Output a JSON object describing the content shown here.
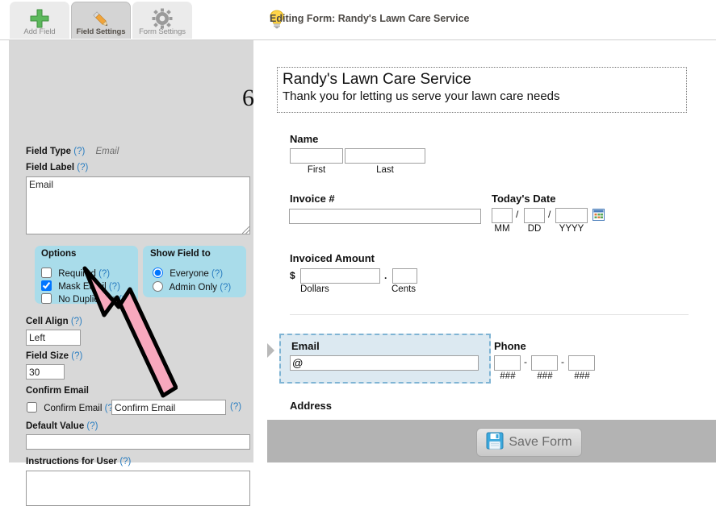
{
  "tabs": [
    {
      "label": "Add Field",
      "icon": "plus-icon",
      "active": false
    },
    {
      "label": "Field Settings",
      "icon": "pencil-icon",
      "active": true
    },
    {
      "label": "Form Settings",
      "icon": "gear-icon",
      "active": false
    }
  ],
  "header": {
    "icon": "lightbulb-icon",
    "title": "Editing Form: Randy's Lawn Care Service"
  },
  "sidebar": {
    "field_number": "6",
    "field_type_label": "Field Type",
    "field_type_value": "Email",
    "field_label_label": "Field Label",
    "field_label_value": "Email",
    "help_marker": "(?)",
    "options": {
      "title": "Options",
      "items": [
        {
          "label": "Required",
          "checked": false
        },
        {
          "label": "Mask Email",
          "checked": true
        },
        {
          "label": "No Duplicates",
          "checked": false
        }
      ]
    },
    "show_field_to": {
      "title": "Show Field to",
      "items": [
        {
          "label": "Everyone",
          "selected": true
        },
        {
          "label": "Admin Only",
          "selected": false
        }
      ]
    },
    "cell_align_label": "Cell Align",
    "cell_align_value": "Left",
    "field_size_label": "Field Size",
    "field_size_value": "30",
    "confirm_email_heading": "Confirm Email",
    "confirm_email_checkbox_label": "Confirm Email",
    "confirm_email_input_value": "Confirm Email",
    "default_value_label": "Default Value",
    "default_value_value": "",
    "instructions_label": "Instructions for User",
    "instructions_value": ""
  },
  "preview": {
    "form_title": "Randy's Lawn Care Service",
    "form_subtitle": "Thank you for letting us serve your lawn care needs",
    "name": {
      "label": "Name",
      "first_sub": "First",
      "last_sub": "Last",
      "first_value": "",
      "last_value": ""
    },
    "invoice": {
      "label": "Invoice #",
      "value": ""
    },
    "date": {
      "label": "Today's Date",
      "mm_value": "",
      "dd_value": "",
      "yyyy_value": "",
      "mm_sub": "MM",
      "dd_sub": "DD",
      "yyyy_sub": "YYYY",
      "separator": "/",
      "picker_icon": "calendar-icon"
    },
    "amount": {
      "label": "Invoiced Amount",
      "currency": "$",
      "decimal": ".",
      "dollars_sub": "Dollars",
      "cents_sub": "Cents",
      "dollars_value": "",
      "cents_value": ""
    },
    "email": {
      "label": "Email",
      "value": "@",
      "selected": true
    },
    "phone": {
      "label": "Phone",
      "separator": "-",
      "part_sub": "###",
      "p1": "",
      "p2": "",
      "p3": ""
    },
    "address": {
      "label": "Address"
    }
  },
  "footer": {
    "save_label": "Save Form",
    "save_icon": "floppy-disk-icon"
  },
  "annotation": {
    "arrow": "pink-arrow-pointing-to-mask-email",
    "color": "#f7a8bd"
  },
  "colors": {
    "sidebar_bg": "#d8d8d8",
    "option_panel": "#a9dcea",
    "selected_field_bg": "#dce9f1",
    "selected_field_border": "#7fb4d4",
    "footer_bg": "#b3b3b3",
    "help_link": "#2b7ec1"
  }
}
